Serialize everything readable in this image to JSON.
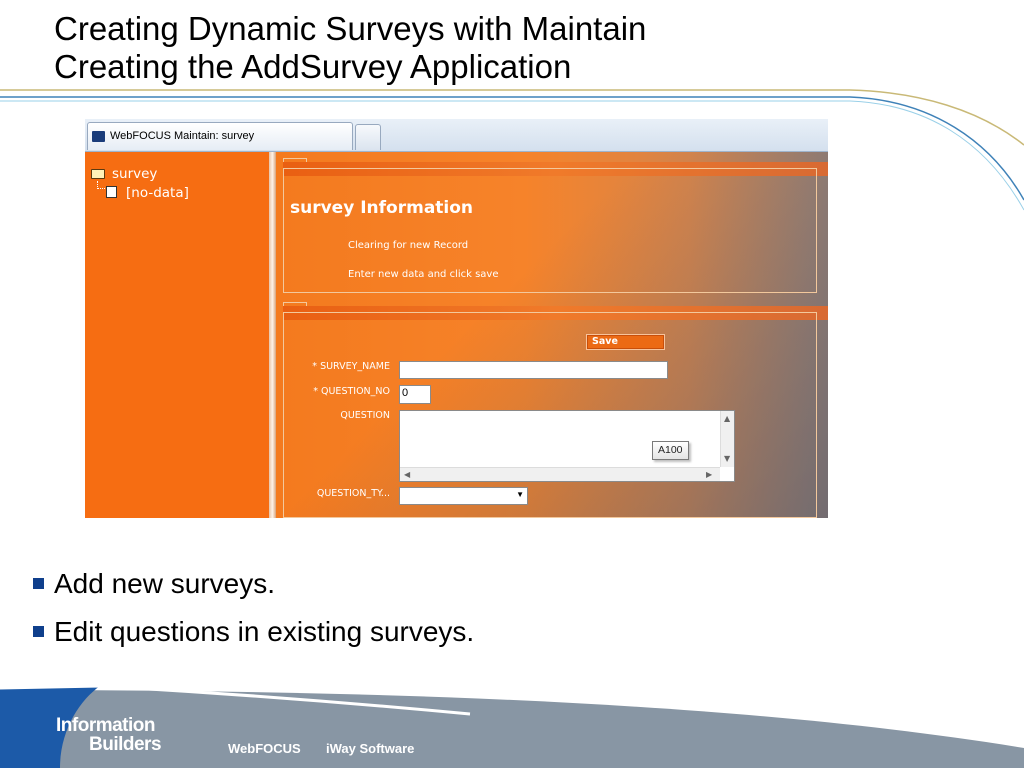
{
  "slide": {
    "title_line1": "Creating Dynamic Surveys with Maintain",
    "title_line2": "Creating the AddSurvey Application"
  },
  "screenshot": {
    "tab_title": "WebFOCUS Maintain: survey",
    "tree": {
      "root": "survey",
      "child": "[no-data]"
    },
    "info_panel": {
      "title": "survey Information",
      "message1": "Clearing for new Record",
      "message2": "Enter new data and click save"
    },
    "form": {
      "save_label": "Save",
      "survey_name_label": "* SURVEY_NAME",
      "survey_name_value": "",
      "question_no_label": "* QUESTION_NO",
      "question_no_value": "0",
      "question_label": "QUESTION",
      "question_tooltip": "A100",
      "question_type_label": "QUESTION_TY..."
    }
  },
  "bullets": [
    "Add new surveys.",
    "Edit questions in existing surveys."
  ],
  "footer": {
    "logo_line1": "Information",
    "logo_line2": "Builders",
    "item1": "WebFOCUS",
    "item2": "iWay Software"
  },
  "colors": {
    "accent_orange": "#f4741f",
    "bullet_blue": "#0f3f8c",
    "footer_blue": "#1c5aa8",
    "footer_gray": "#8896a4"
  }
}
